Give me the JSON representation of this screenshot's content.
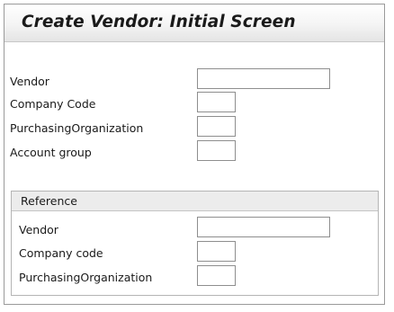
{
  "header": {
    "title": "Create Vendor:  Initial Screen"
  },
  "main_fields": [
    {
      "label": "Vendor",
      "value": ""
    },
    {
      "label": "Company Code",
      "value": ""
    },
    {
      "label": "PurchasingOrganization",
      "value": ""
    },
    {
      "label": "Account group",
      "value": ""
    }
  ],
  "reference": {
    "title": "Reference",
    "fields": [
      {
        "label": "Vendor",
        "value": ""
      },
      {
        "label": "Company code",
        "value": ""
      },
      {
        "label": "PurchasingOrganization",
        "value": ""
      }
    ]
  }
}
